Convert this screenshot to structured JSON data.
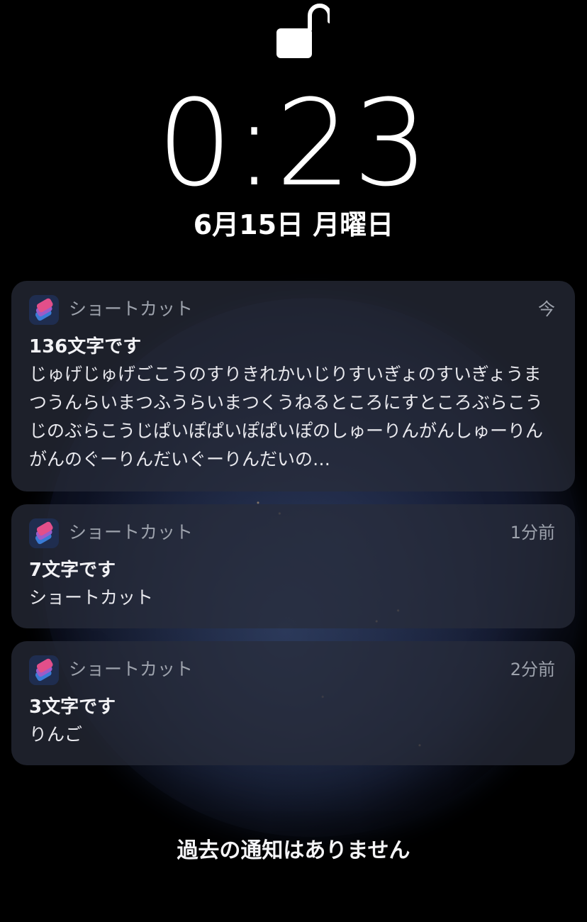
{
  "lock": {
    "icon": "unlocked-padlock-icon"
  },
  "clock": {
    "time": "0:23",
    "date": "6月15日 月曜日"
  },
  "notifications": [
    {
      "app_name": "ショートカット",
      "app_icon": "shortcuts-app-icon",
      "time": "今",
      "title": "136文字です",
      "body": "じゅげじゅげごこうのすりきれかいじりすいぎょのすいぎょうまつうんらいまつふうらいまつくうねるところにすところぶらこうじのぶらこうじぱいぽぱいぽぱいぽのしゅーりんがんしゅーりんがんのぐーりんだいぐーりんだいの…"
    },
    {
      "app_name": "ショートカット",
      "app_icon": "shortcuts-app-icon",
      "time": "1分前",
      "title": "7文字です",
      "body": "ショートカット"
    },
    {
      "app_name": "ショートカット",
      "app_icon": "shortcuts-app-icon",
      "time": "2分前",
      "title": "3文字です",
      "body": "りんご"
    }
  ],
  "footer": {
    "no_older": "過去の通知はありません"
  },
  "colors": {
    "background": "#000000",
    "card": "#282c3a",
    "secondary_text": "#9ea3ad",
    "shortcuts_pink": "#e24f8a",
    "shortcuts_blue": "#3a7bd5"
  }
}
